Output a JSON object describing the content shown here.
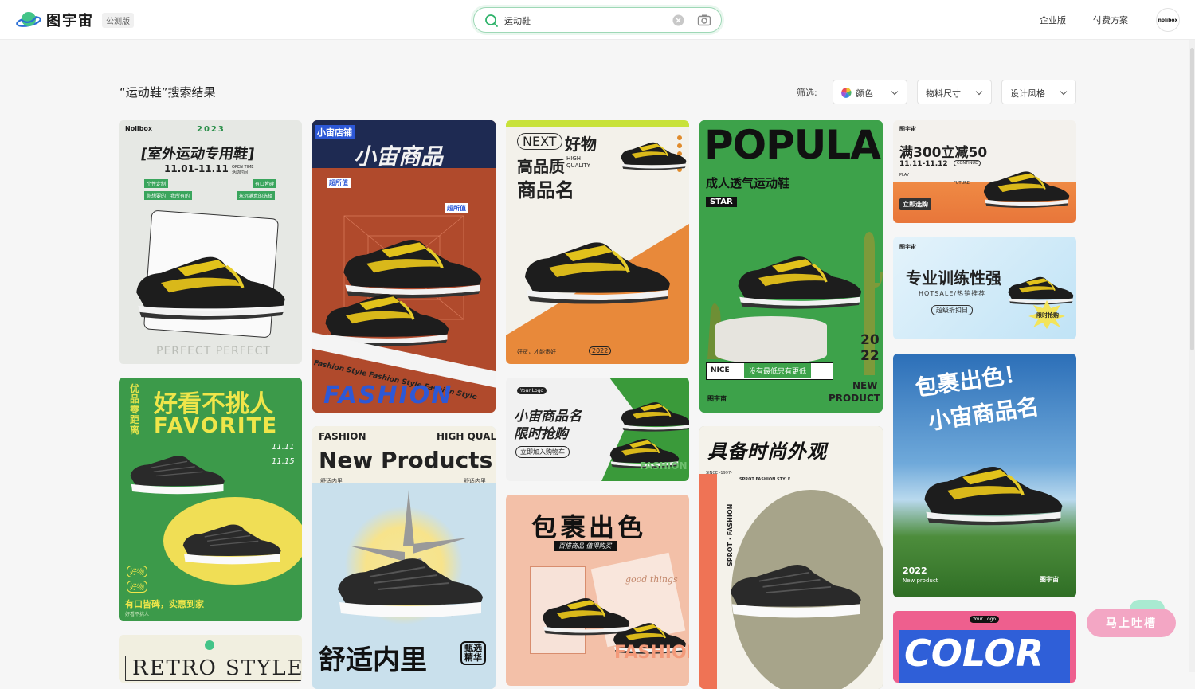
{
  "header": {
    "app_name": "图宇宙",
    "beta_badge": "公测版",
    "search_value": "运动鞋",
    "nav": [
      "企业版",
      "付费方案"
    ],
    "avatar_text": "nolibox"
  },
  "results": {
    "title": "“运动鞋”搜索结果",
    "filter_label": "筛选:",
    "filters": [
      "颜色",
      "物料尺寸",
      "设计风格"
    ]
  },
  "cards": {
    "c1": {
      "brand": "Nolibox",
      "year": "2023",
      "title": "[室外运动专用鞋]",
      "dates": "11.01-11.11",
      "open_time": "OPEN TIME 活动时间",
      "tag1": "个性定制",
      "tag2": "有口皆碑",
      "tag3": "你想要的，我所有的",
      "tag4": "永远满意的选择",
      "footer": "PERFECT PERFECT"
    },
    "c2": {
      "store": "小宙店铺",
      "title": "小宙商品",
      "badge1": "超所值",
      "badge2": "超所值",
      "ribbon": "Fashion Style Fashion Style Fashion Style",
      "big": "FASHION"
    },
    "c3": {
      "next": "NEXT",
      "title1": "好物",
      "title2": "高品质",
      "quality": "HIGH QUALITY",
      "title3": "商品名",
      "footer": "好货，才能贵好",
      "year": "2022"
    },
    "c4": {
      "big": "POPULAR",
      "subtitle": "成人透气运动鞋",
      "star": "STAR",
      "nice": "NICE",
      "slogan": "没有最低只有更低",
      "year1": "20",
      "year2": "22",
      "new1": "NEW",
      "new2": "PRODUCT",
      "brand": "图宇宙"
    },
    "c5": {
      "brand": "图宇宙",
      "title": "满300立减50",
      "dates": "11.11-11.12",
      "cont": "CONTINUE",
      "play": "PLAY",
      "future": "FUTURE",
      "btn": "立即选购"
    },
    "c6": {
      "brand": "图宇宙",
      "title": "专业训练性强",
      "sub": "HOTSALE/热销推荐",
      "btn": "超级折扣日",
      "burst": "限时抢购"
    },
    "c7": {
      "title": "好看不挑人",
      "big": "FAVORITE",
      "side": "优品零距离",
      "d1": "11.11",
      "d2": "11.15",
      "tag1": "好物",
      "tag2": "好物",
      "footer": "有口皆碑，实惠到家",
      "sub": "好看不挑人"
    },
    "c8": {
      "left": "FASHION",
      "right": "HIGH QUALITY",
      "big": "New Products",
      "sub1": "舒适内里",
      "sub2": "舒适内里",
      "bottom": "舒适内里",
      "stamp": "甄选精华"
    },
    "c9": {
      "logo": "Your Logo",
      "title1": "小宙商品名",
      "title2": "限时抢购",
      "btn": "立即加入购物车",
      "side": "FASHION BOY"
    },
    "c10": {
      "title": "包裹出色",
      "sub": "百搭商品  值得购买",
      "script": "good things",
      "bottom": "FASHION"
    },
    "c11": {
      "title": "具备时尚外观",
      "since": "SINCE -1997-",
      "sport": "SPROT FASHION STYLE",
      "vert": "SPROT · FASHION"
    },
    "c12": {
      "title1": "包裹出色！",
      "title2": "小宙商品名",
      "year": "2022",
      "sub": "New product",
      "brand": "图宇宙"
    },
    "c13": {
      "logo": "Your Logo",
      "big": "COLOR"
    },
    "c14": {
      "big": "RETRO STYLE"
    }
  },
  "feedback": {
    "label": "马上吐槽"
  },
  "colors": {
    "accent": "#2fb36b",
    "brand_green": "#3aa55d"
  }
}
